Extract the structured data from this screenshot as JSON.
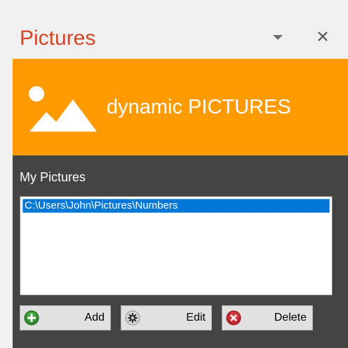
{
  "pane": {
    "title": "Pictures",
    "menu_icon": "chevron-down-icon",
    "close_icon": "close-icon"
  },
  "banner": {
    "icon": "picture-icon",
    "text": "dynamic PICTURES",
    "color": "#ff9b00"
  },
  "pictures": {
    "label": "My Pictures",
    "items": [
      "C:\\Users\\John\\Pictures\\Numbers"
    ],
    "selected_index": 0
  },
  "buttons": {
    "add_label": "Add",
    "add_icon": "plus-icon",
    "edit_label": "Edit",
    "edit_icon": "gear-icon",
    "delete_label": "Delete",
    "delete_icon": "delete-icon"
  },
  "colors": {
    "title": "#d24726",
    "body": "#444444",
    "selection": "#0078d7"
  }
}
